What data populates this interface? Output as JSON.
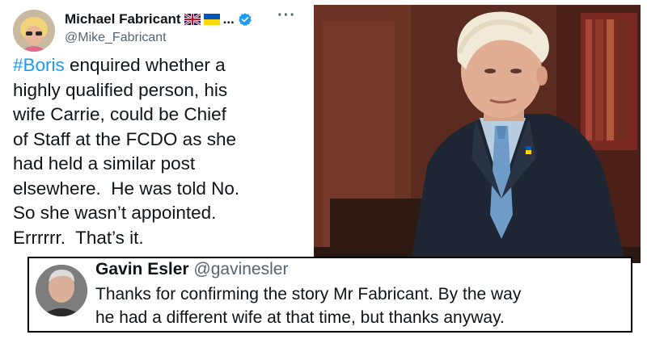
{
  "tweet": {
    "author_name": "Michael Fabricant",
    "name_suffix": "...",
    "handle": "@Mike_Fabricant",
    "more_label": "···",
    "hashtag": "#Boris",
    "body_rest": " enquired whether a\nhighly qualified person, his\nwife Carrie, could be Chief\nof Staff at the FCDO as she\nhad held a similar post\nelsewhere.  He was told No.\nSo she wasn’t appointed.\nErrrrrr.  That’s it.",
    "icons": [
      "uk-flag-icon",
      "ukraine-flag-icon",
      "verified-badge-icon",
      "more-options-icon"
    ],
    "colors": {
      "hashtag": "#1d9bf0",
      "verified": "#1d9bf0",
      "handle": "#536471"
    }
  },
  "reply": {
    "author_name": "Gavin Esler",
    "handle": "@gavinesler",
    "line1": "Thanks for confirming the story Mr Fabricant. By the way",
    "line2": "he had a different wife at that time, but thanks anyway."
  }
}
